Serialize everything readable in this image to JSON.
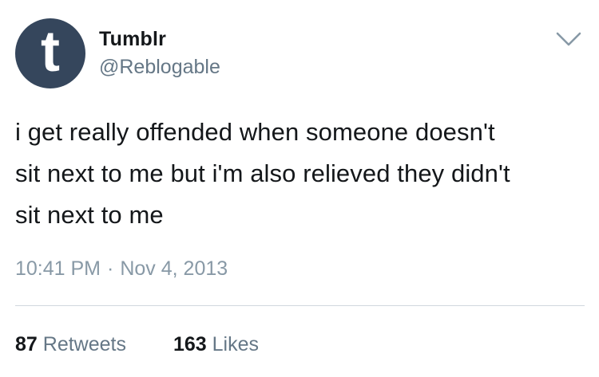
{
  "author": {
    "avatar_letter": "t",
    "avatar_color": "#35465c",
    "display_name": "Tumblr",
    "handle": "@Reblogable"
  },
  "menu": {
    "icon": "chevron-down-icon"
  },
  "tweet": {
    "lines": [
      "i get really offended when someone doesn't",
      "sit next to me but i'm also relieved they didn't",
      "sit next to me"
    ],
    "time": "10:41 PM",
    "separator": "·",
    "date": "Nov 4, 2013"
  },
  "stats": {
    "retweets_count": "87",
    "retweets_label": "Retweets",
    "likes_count": "163",
    "likes_label": "Likes"
  }
}
